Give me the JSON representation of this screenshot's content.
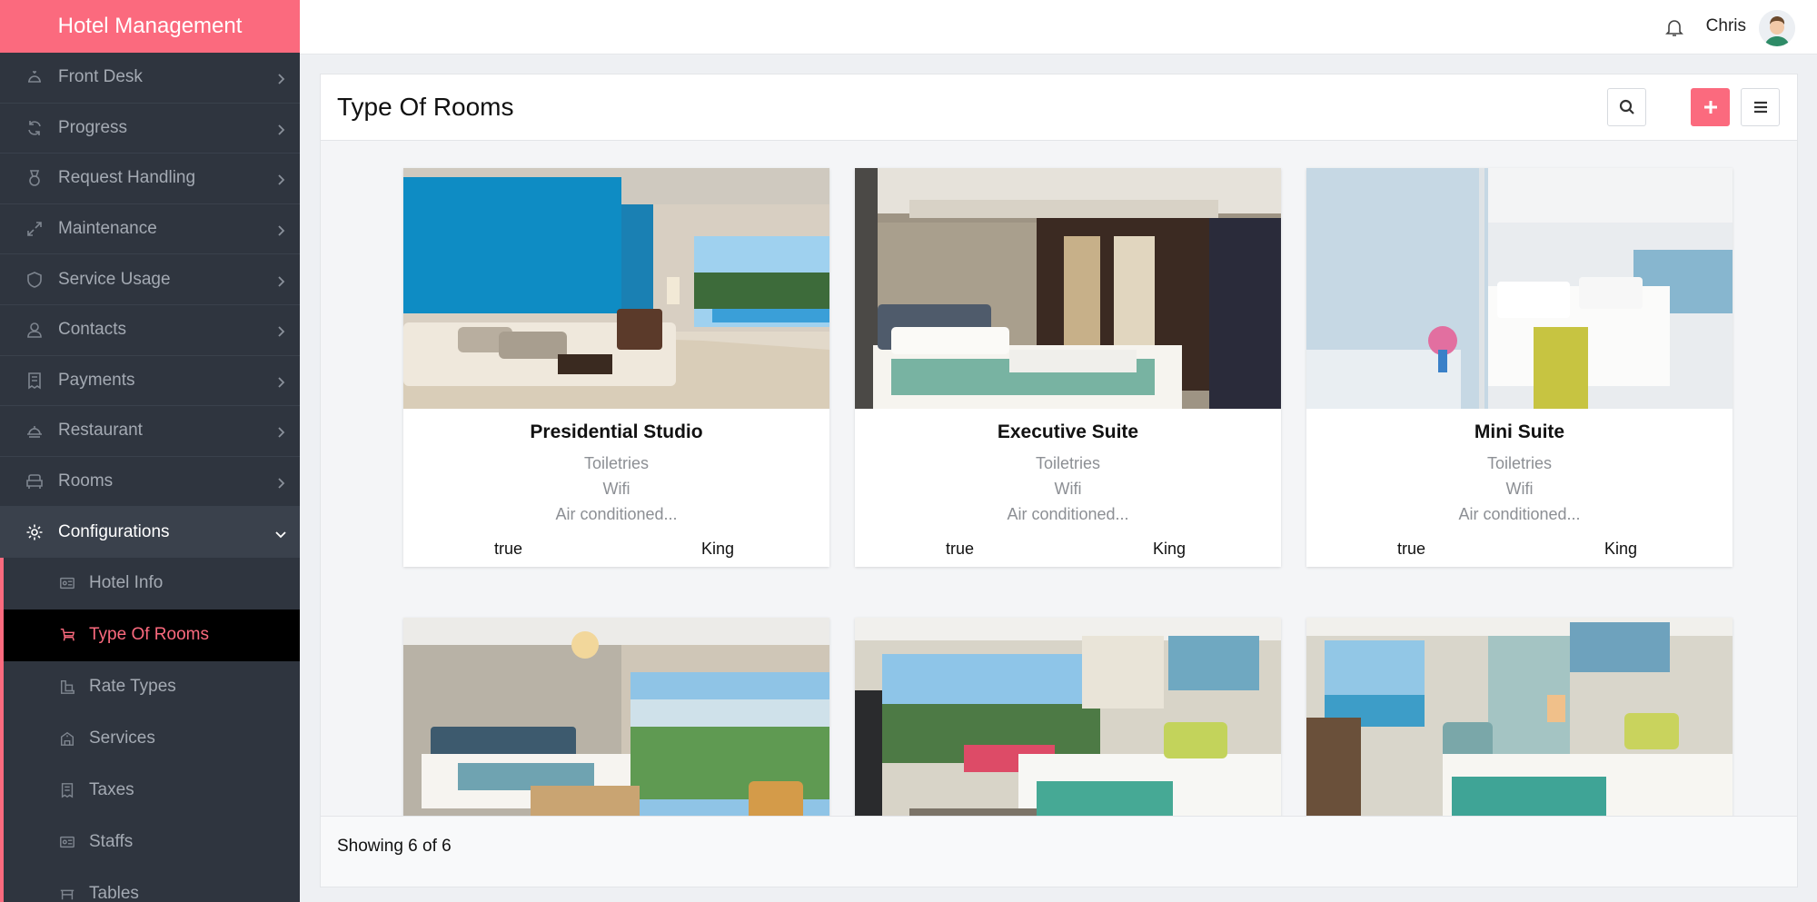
{
  "app": {
    "title": "Hotel Management"
  },
  "topbar": {
    "username": "Chris"
  },
  "sidebar": {
    "items": [
      {
        "label": "Front Desk",
        "icon": "bell-service-icon"
      },
      {
        "label": "Progress",
        "icon": "refresh-icon"
      },
      {
        "label": "Request Handling",
        "icon": "medal-icon"
      },
      {
        "label": "Maintenance",
        "icon": "expand-arrow-icon"
      },
      {
        "label": "Service Usage",
        "icon": "shield-icon"
      },
      {
        "label": "Contacts",
        "icon": "user-icon"
      },
      {
        "label": "Payments",
        "icon": "receipt-icon"
      },
      {
        "label": "Restaurant",
        "icon": "dish-icon"
      },
      {
        "label": "Rooms",
        "icon": "armchair-icon"
      },
      {
        "label": "Configurations",
        "icon": "gear-icon"
      }
    ],
    "submenu": [
      {
        "label": "Hotel Info",
        "icon": "id-card-icon"
      },
      {
        "label": "Type Of Rooms",
        "icon": "cart-icon"
      },
      {
        "label": "Rate Types",
        "icon": "tag-icon"
      },
      {
        "label": "Services",
        "icon": "building-icon"
      },
      {
        "label": "Taxes",
        "icon": "receipt-icon"
      },
      {
        "label": "Staffs",
        "icon": "id-card-icon"
      },
      {
        "label": "Tables",
        "icon": "table-icon"
      }
    ]
  },
  "page": {
    "title": "Type Of Rooms"
  },
  "rooms": [
    {
      "name": "Presidential Studio",
      "amenities": [
        "Toiletries",
        "Wifi",
        "Air conditioned..."
      ],
      "available": "true",
      "bed": "King"
    },
    {
      "name": "Executive Suite",
      "amenities": [
        "Toiletries",
        "Wifi",
        "Air conditioned..."
      ],
      "available": "true",
      "bed": "King"
    },
    {
      "name": "Mini Suite",
      "amenities": [
        "Toiletries",
        "Wifi",
        "Air conditioned..."
      ],
      "available": "true",
      "bed": "King"
    },
    {
      "name": "",
      "amenities": [],
      "available": "",
      "bed": ""
    },
    {
      "name": "",
      "amenities": [],
      "available": "",
      "bed": ""
    },
    {
      "name": "",
      "amenities": [],
      "available": "",
      "bed": ""
    }
  ],
  "footer": {
    "showing": "Showing 6 of 6"
  },
  "colors": {
    "accent": "#fb6a7e",
    "sidebar_bg": "#2f353f",
    "active_bg": "#000000"
  }
}
